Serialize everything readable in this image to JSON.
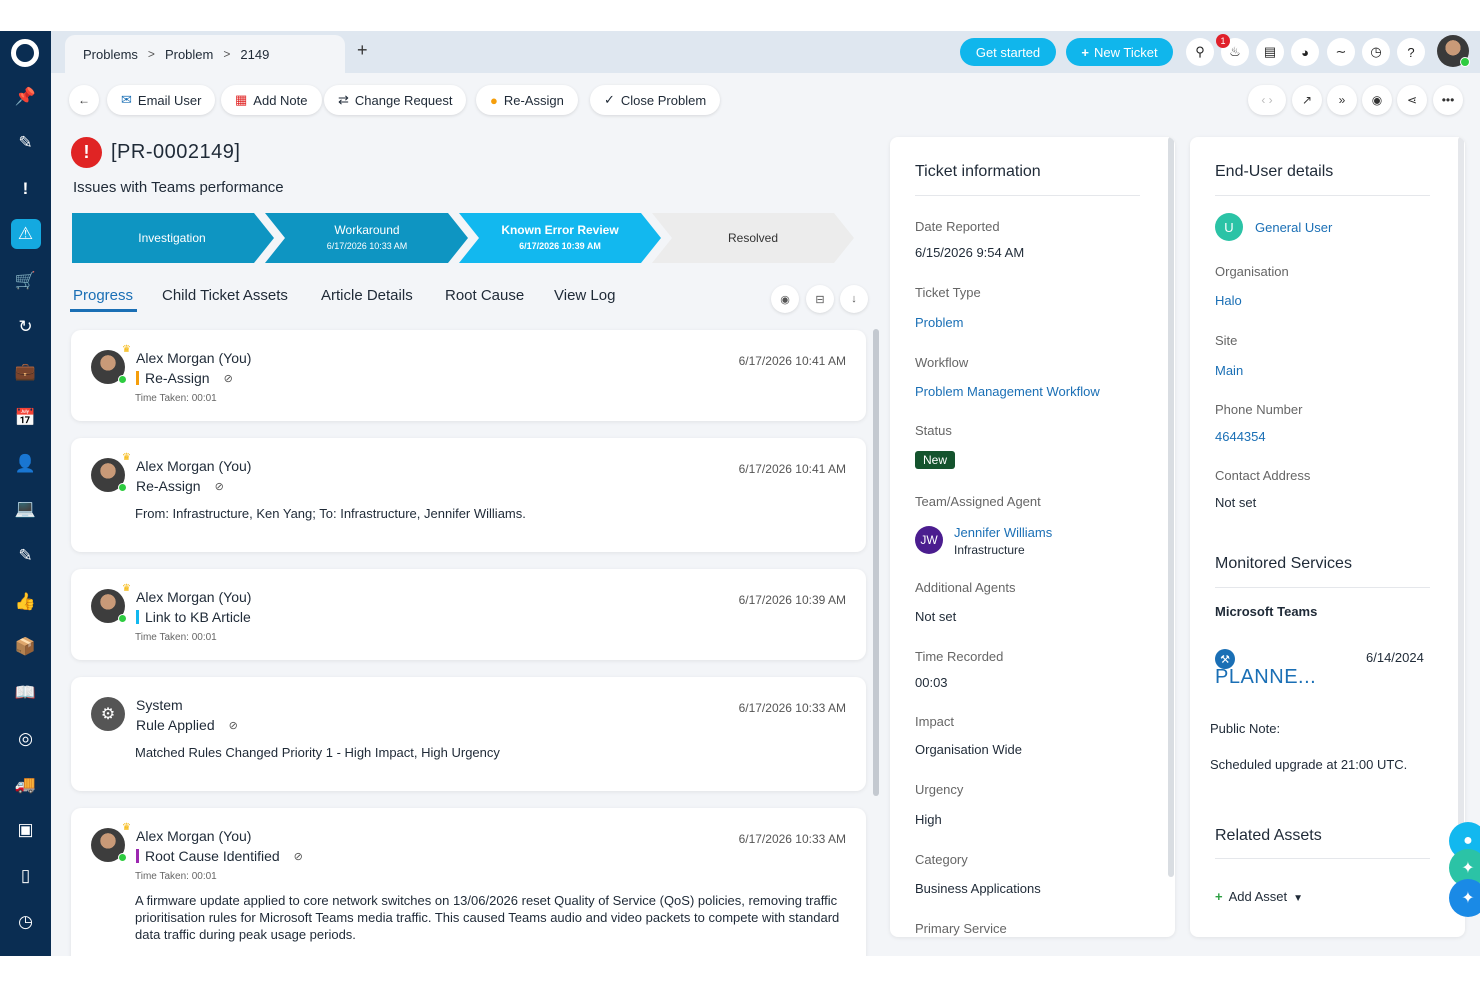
{
  "nav": {
    "items": [
      "pin-icon",
      "ticket-icon",
      "exclamation-icon",
      "warning-icon",
      "cart-icon",
      "refresh-icon",
      "briefcase-icon",
      "calendar-icon",
      "user-icon",
      "laptop-icon",
      "edit-icon",
      "thumbs-up-icon",
      "box-icon",
      "book-icon",
      "target-icon",
      "truck-icon",
      "cube-icon",
      "device-icon",
      "clock-icon"
    ]
  },
  "breadcrumb": {
    "part1": "Problems",
    "part2": "Problem",
    "part3": "2149",
    "sep": ">"
  },
  "topbar": {
    "get_started": "Get started",
    "new_ticket": "New Ticket",
    "notification_count": "1"
  },
  "actions": {
    "email_user": "Email User",
    "add_note": "Add Note",
    "change_request": "Change Request",
    "re_assign": "Re-Assign",
    "close_problem": "Close Problem"
  },
  "ticket": {
    "id": "[PR-0002149]",
    "summary": "Issues with Teams performance",
    "stages": [
      {
        "name": "Investigation",
        "date": "",
        "color": "#0e95c2"
      },
      {
        "name": "Workaround",
        "date": "6/17/2026 10:33 AM",
        "color": "#0e95c2"
      },
      {
        "name": "Known Error Review",
        "date": "6/17/2026 10:39 AM",
        "color": "#12b8ef"
      },
      {
        "name": "Resolved",
        "date": "",
        "color": "#ececec"
      }
    ]
  },
  "tabs": [
    "Progress",
    "Child Ticket Assets",
    "Article Details",
    "Root Cause",
    "View Log"
  ],
  "feed": [
    {
      "name": "Alex Morgan (You)",
      "action": "Re-Assign",
      "bar": "#f59e0b",
      "date": "6/17/2026 10:41 AM",
      "time": "Time Taken: 00:01",
      "body": ""
    },
    {
      "name": "Alex Morgan (You)",
      "action": "Re-Assign",
      "bar": "",
      "date": "6/17/2026 10:41 AM",
      "time": "",
      "body": "From: Infrastructure, Ken Yang; To: Infrastructure, Jennifer Williams."
    },
    {
      "name": "Alex Morgan (You)",
      "action": "Link to KB Article",
      "bar": "#12b8ef",
      "date": "6/17/2026 10:39 AM",
      "time": "Time Taken: 00:01",
      "body": ""
    },
    {
      "name": "System",
      "action": "Rule Applied",
      "bar": "",
      "date": "6/17/2026 10:33 AM",
      "time": "",
      "body": "Matched Rules Changed Priority 1 - High Impact, High Urgency"
    },
    {
      "name": "Alex Morgan (You)",
      "action": "Root Cause Identified",
      "bar": "#9c27b0",
      "date": "6/17/2026 10:33 AM",
      "time": "Time Taken: 00:01",
      "body": "A firmware update applied to core network switches on 13/06/2026 reset Quality of Service (QoS) policies, removing traffic prioritisation rules for Microsoft Teams media traffic. This caused Teams audio and video packets to compete with standard data traffic during peak usage periods."
    }
  ],
  "ticket_info": {
    "title": "Ticket information",
    "date_reported_label": "Date Reported",
    "date_reported": "6/15/2026 9:54 AM",
    "ticket_type_label": "Ticket Type",
    "ticket_type": "Problem",
    "workflow_label": "Workflow",
    "workflow": "Problem Management Workflow",
    "status_label": "Status",
    "status": "New",
    "team_label": "Team/Assigned Agent",
    "agent_initials": "JW",
    "agent": "Jennifer Williams",
    "team": "Infrastructure",
    "additional_label": "Additional Agents",
    "additional": "Not set",
    "time_label": "Time Recorded",
    "time": "00:03",
    "impact_label": "Impact",
    "impact": "Organisation Wide",
    "urgency_label": "Urgency",
    "urgency": "High",
    "category_label": "Category",
    "category": "Business Applications",
    "primary_service_label": "Primary Service"
  },
  "end_user": {
    "title": "End-User details",
    "user_initial": "U",
    "user": "General User",
    "org_label": "Organisation",
    "org": "Halo",
    "site_label": "Site",
    "site": "Main",
    "phone_label": "Phone Number",
    "phone": "4644354",
    "address_label": "Contact Address",
    "address": "Not set",
    "services_title": "Monitored Services",
    "service_name": "Microsoft Teams",
    "service_status": "PLANNE...",
    "service_date": "6/14/2024",
    "public_note_label": "Public Note:",
    "public_note": "Scheduled upgrade at 21:00 UTC.",
    "assets_title": "Related Assets",
    "add_asset": "Add Asset"
  }
}
